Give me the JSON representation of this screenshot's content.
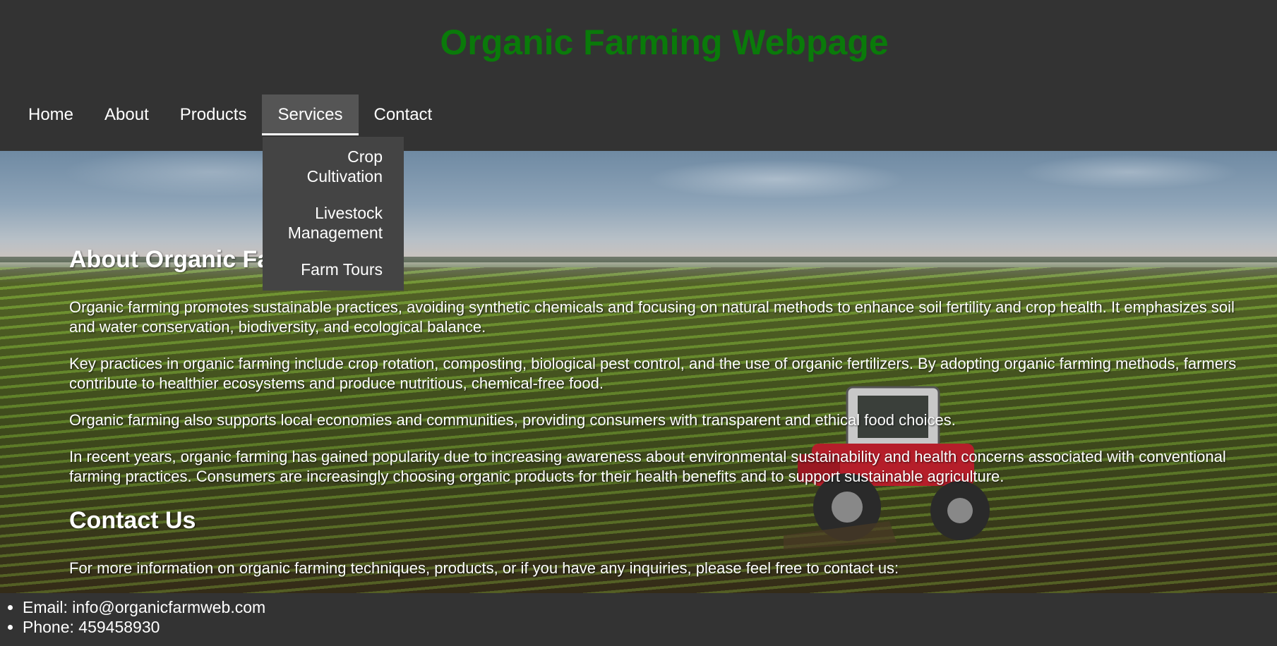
{
  "header": {
    "title": "Organic Farming Webpage",
    "title_color": "#0a7a0a"
  },
  "nav": {
    "items": [
      {
        "label": "Home"
      },
      {
        "label": "About"
      },
      {
        "label": "Products"
      },
      {
        "label": "Services",
        "active": true
      },
      {
        "label": "Contact"
      }
    ],
    "services_dropdown": [
      {
        "label": "Crop Cultivation"
      },
      {
        "label": "Livestock Management"
      },
      {
        "label": "Farm Tours"
      }
    ]
  },
  "about": {
    "heading": "About Organic Farming",
    "paragraphs": [
      "Organic farming promotes sustainable practices, avoiding synthetic chemicals and focusing on natural methods to enhance soil fertility and crop health. It emphasizes soil and water conservation, biodiversity, and ecological balance.",
      "Key practices in organic farming include crop rotation, composting, biological pest control, and the use of organic fertilizers. By adopting organic farming methods, farmers contribute to healthier ecosystems and produce nutritious, chemical-free food.",
      "Organic farming also supports local economies and communities, providing consumers with transparent and ethical food choices.",
      "In recent years, organic farming has gained popularity due to increasing awareness about environmental sustainability and health concerns associated with conventional farming practices. Consumers are increasingly choosing organic products for their health benefits and to support sustainable agriculture."
    ]
  },
  "contact": {
    "heading": "Contact Us",
    "intro": "For more information on organic farming techniques, products, or if you have any inquiries, please feel free to contact us:",
    "items": [
      "Email: info@organicfarmweb.com",
      "Phone: 459458930"
    ]
  },
  "hero_image": "field-with-tractor-image"
}
